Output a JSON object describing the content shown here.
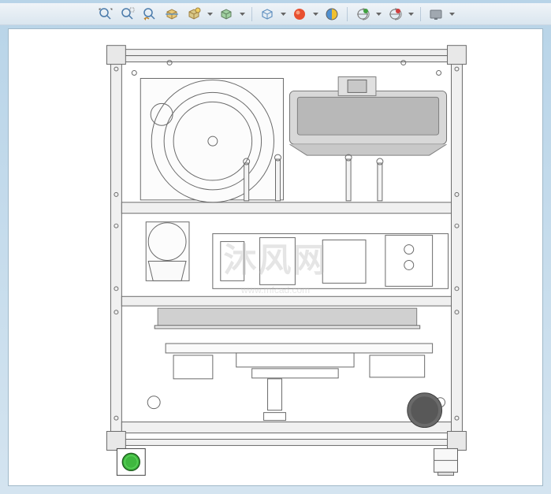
{
  "toolbar": {
    "icons": [
      {
        "name": "zoom-to-fit-icon",
        "glyph": "⊕"
      },
      {
        "name": "zoom-area-icon",
        "glyph": "⊖"
      },
      {
        "name": "previous-view-icon",
        "glyph": "↶"
      },
      {
        "name": "section-view-icon",
        "glyph": "▤"
      },
      {
        "name": "dynamic-annotation-icon",
        "glyph": "▦"
      },
      {
        "name": "display-style-icon",
        "glyph": "◫"
      },
      {
        "name": "hide-show-icon",
        "glyph": "◱"
      },
      {
        "name": "edit-appearance-icon",
        "glyph": "●"
      },
      {
        "name": "apply-scene-icon",
        "glyph": "◉"
      },
      {
        "name": "view-settings-icon",
        "glyph": "⚙"
      },
      {
        "name": "render-icon",
        "glyph": "◐"
      },
      {
        "name": "display-pane-icon",
        "glyph": "▭"
      }
    ]
  },
  "watermark": {
    "text": "沐风网",
    "subtext": "www.mfcad.com"
  },
  "drawing": {
    "frame": {
      "stroke": "#6a6a6a",
      "fill": "#f2f2f2"
    },
    "button_green": "#3fb83f",
    "button_dark": "#555555"
  }
}
